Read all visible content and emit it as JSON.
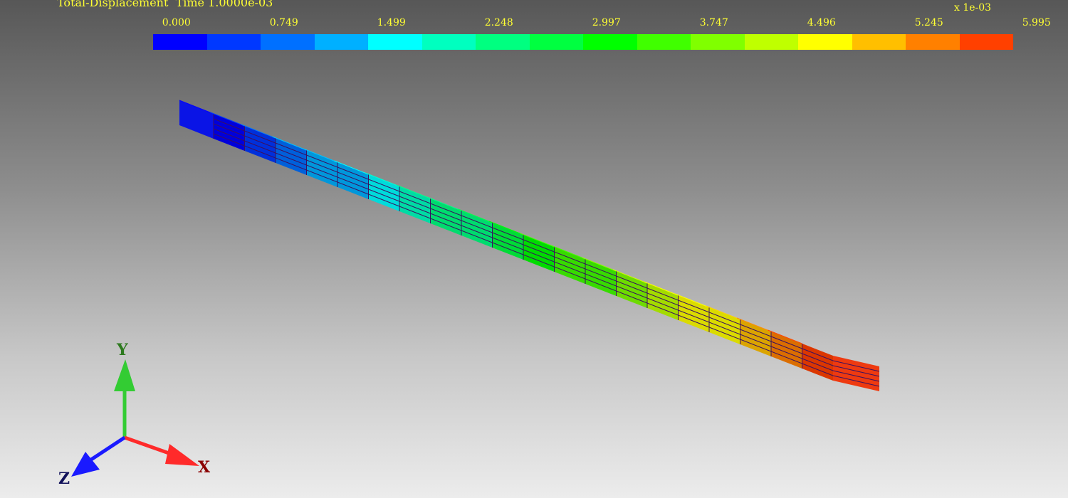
{
  "viewer": {
    "title": "Total-Displacement  Time 1.0000e-03",
    "scale_factor": "x  1e-03"
  },
  "legend": {
    "tick_labels": [
      "0.000",
      "0.749",
      "1.499",
      "2.248",
      "2.997",
      "3.747",
      "4.496",
      "5.245",
      "5.995"
    ],
    "colors": [
      "#0000ff",
      "#0038ff",
      "#0070ff",
      "#00b0ff",
      "#00ffff",
      "#00ffbf",
      "#00ff80",
      "#00ff40",
      "#00ff00",
      "#40ff00",
      "#80ff00",
      "#bfff00",
      "#ffff00",
      "#ffbf00",
      "#ff8000",
      "#ff4000"
    ]
  },
  "axes": {
    "x_label": "X",
    "y_label": "Y",
    "z_label": "Z",
    "x_color": "#ff2a2a",
    "y_color": "#33cc33",
    "z_color": "#1a1aff"
  }
}
